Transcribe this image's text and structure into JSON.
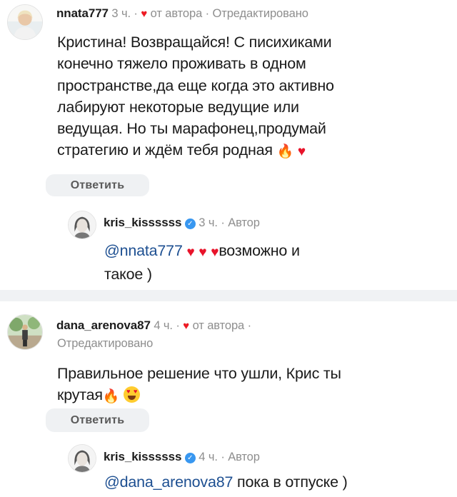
{
  "comments": [
    {
      "username": "nnata777",
      "time": "3 ч.",
      "sep": "·",
      "liked_by_author": "от автора",
      "edited": "· Отредактировано",
      "text_lines": [
        "Кристина! Возвращайся! С писихиками",
        "конечно тяжело проживать в одном",
        "пространстве,да еще когда это активно",
        "лабируют некоторые ведущие или",
        "ведущая. Но ты марафонец,продумай",
        "стратегию и ждём тебя родная"
      ],
      "reply_label": "Ответить",
      "reply": {
        "username": "kris_kissssss",
        "time": "3 ч.",
        "tag": "· Автор",
        "mention": "@nnata777",
        "text_after": "возможно и",
        "text_line2": "такое )"
      }
    },
    {
      "username": "dana_arenova87",
      "time": "4 ч.",
      "sep": "·",
      "liked_by_author": "от автора ·",
      "edited": "Отредактировано",
      "text_lines": [
        "Правильное решение что ушли, Крис ты",
        "крутая"
      ],
      "reply_label": "Ответить",
      "reply": {
        "username": "kris_kissssss",
        "time": "4 ч.",
        "tag": "· Автор",
        "mention": "@dana_arenova87",
        "text_after": "пока в отпуске )"
      }
    }
  ],
  "icons": {
    "heart": "♥",
    "check": "✓",
    "fire": "🔥",
    "emoji_heart": "♥"
  },
  "colors": {
    "mention": "#1d4f91",
    "meta_gray": "#8e8e8e",
    "heart_red": "#ed1b24",
    "verified_blue": "#3897f0"
  }
}
